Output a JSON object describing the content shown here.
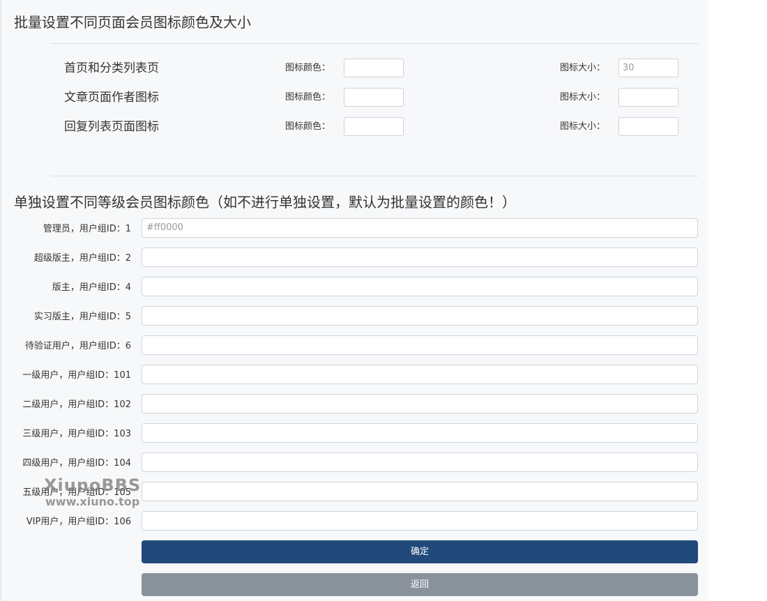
{
  "batch_section": {
    "title": "批量设置不同页面会员图标颜色及大小",
    "rows": [
      {
        "label": "首页和分类列表页",
        "color_label": "图标颜色：",
        "color_value": "",
        "size_label": "图标大小：",
        "size_value": "30"
      },
      {
        "label": "文章页面作者图标",
        "color_label": "图标颜色：",
        "color_value": "",
        "size_label": "图标大小：",
        "size_value": ""
      },
      {
        "label": "回复列表页面图标",
        "color_label": "图标颜色：",
        "color_value": "",
        "size_label": "图标大小：",
        "size_value": ""
      }
    ]
  },
  "level_section": {
    "title": "单独设置不同等级会员图标颜色（如不进行单独设置，默认为批量设置的颜色！）",
    "rows": [
      {
        "label": "管理员，用户组ID：1",
        "value": "#ff0000"
      },
      {
        "label": "超级版主，用户组ID：2",
        "value": ""
      },
      {
        "label": "版主，用户组ID：4",
        "value": ""
      },
      {
        "label": "实习版主，用户组ID：5",
        "value": ""
      },
      {
        "label": "待验证用户，用户组ID：6",
        "value": ""
      },
      {
        "label": "一级用户，用户组ID：101",
        "value": ""
      },
      {
        "label": "二级用户，用户组ID：102",
        "value": ""
      },
      {
        "label": "三级用户，用户组ID：103",
        "value": ""
      },
      {
        "label": "四级用户，用户组ID：104",
        "value": ""
      },
      {
        "label": "五级用户，用户组ID：105",
        "value": ""
      },
      {
        "label": "VIP用户，用户组ID：106",
        "value": ""
      }
    ]
  },
  "buttons": {
    "confirm": "确定",
    "back": "返回"
  },
  "watermark": {
    "line1": "XiunoBBS",
    "line2": "www.xiuno.top"
  },
  "colors": {
    "primary_button": "#21497a",
    "secondary_button": "#8a939c",
    "background": "#f7f8f9"
  }
}
